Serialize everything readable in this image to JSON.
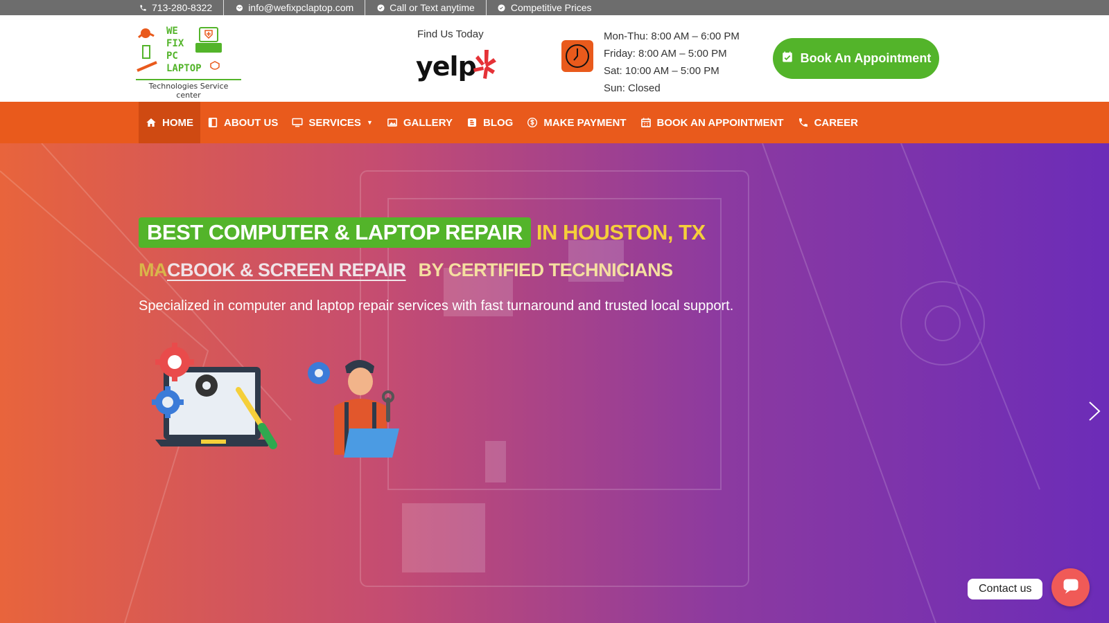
{
  "topbar": {
    "phone": "713-280-8322",
    "email": "info@wefixpclaptop.com",
    "call": "Call or Text anytime",
    "prices": "Competitive Prices"
  },
  "logo": {
    "lines": [
      "WE",
      "FIX",
      "PC",
      "LAPTOP"
    ],
    "tagline": "Technologies Service center"
  },
  "header": {
    "find_us": "Find Us Today",
    "yelp": "yelp",
    "hours": [
      "Mon-Thu: 8:00 AM – 6:00 PM",
      "Friday: 8:00 AM – 5:00 PM",
      "Sat: 10:00 AM – 5:00 PM",
      "Sun: Closed"
    ],
    "book_label": "Book An Appointment"
  },
  "nav": {
    "items": [
      {
        "label": "HOME",
        "icon": "home-icon"
      },
      {
        "label": "ABOUT US",
        "icon": "book-icon"
      },
      {
        "label": "SERVICES",
        "icon": "monitor-icon"
      },
      {
        "label": "GALLERY",
        "icon": "image-icon"
      },
      {
        "label": "BLOG",
        "icon": "blogger-icon"
      },
      {
        "label": "MAKE PAYMENT",
        "icon": "dollar-icon"
      },
      {
        "label": "BOOK AN APPOINTMENT",
        "icon": "calendar-icon"
      },
      {
        "label": "CAREER",
        "icon": "phone-icon"
      }
    ]
  },
  "hero": {
    "headline_green": "BEST COMPUTER & LAPTOP REPAIR",
    "headline_yellow": "IN HOUSTON, TX",
    "sub_typed_a": "MA",
    "sub_typed_b": "CBOOK & SCREEN REPAIR",
    "sub_cert": "BY CERTIFIED TECHNICIANS",
    "description": "Specialized in computer and laptop repair services with fast turnaround and trusted local support."
  },
  "contact": {
    "label": "Contact us"
  },
  "colors": {
    "orange": "#e95a1c",
    "green": "#53b42a",
    "yellow": "#f5cf3a",
    "topbar": "#6d6d6d"
  }
}
